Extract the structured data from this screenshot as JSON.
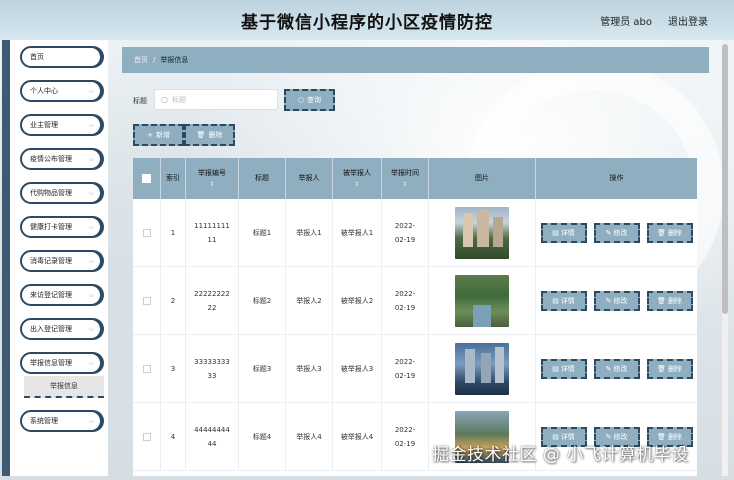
{
  "header": {
    "title": "基于微信小程序的小区疫情防控",
    "user_label": "管理员 abo",
    "logout_label": "退出登录"
  },
  "sidebar": {
    "items": [
      {
        "label": "首页"
      },
      {
        "label": "个人中心"
      },
      {
        "label": "业主管理"
      },
      {
        "label": "疫情公布管理"
      },
      {
        "label": "代购物品管理"
      },
      {
        "label": "健康打卡管理"
      },
      {
        "label": "消毒记录管理"
      },
      {
        "label": "来访登记管理"
      },
      {
        "label": "出入登记管理"
      },
      {
        "label": "举报信息管理"
      },
      {
        "label": "系统管理"
      }
    ],
    "sub_item": "举报信息",
    "chevron": "chevron-down-icon"
  },
  "breadcrumb": {
    "home": "首页",
    "separator": "/",
    "current": "举报信息"
  },
  "search": {
    "label": "标题",
    "placeholder": "标题",
    "button": "查询"
  },
  "actions": {
    "add": "新增",
    "delete": "删除"
  },
  "table": {
    "columns": [
      "索引",
      "举报编号",
      "标题",
      "举报人",
      "被举报人",
      "举报时间",
      "图片",
      "操作"
    ],
    "rows": [
      {
        "index": "1",
        "code": "1111111111",
        "title": "标题1",
        "reporter": "举报人1",
        "reported": "被举报人1",
        "time": "2022-02-19"
      },
      {
        "index": "2",
        "code": "2222222222",
        "title": "标题2",
        "reporter": "举报人2",
        "reported": "被举报人2",
        "time": "2022-02-19"
      },
      {
        "index": "3",
        "code": "3333333333",
        "title": "标题3",
        "reporter": "举报人3",
        "reported": "被举报人3",
        "time": "2022-02-19"
      },
      {
        "index": "4",
        "code": "4444444444",
        "title": "标题4",
        "reporter": "举报人4",
        "reported": "被举报人4",
        "time": "2022-02-19"
      }
    ],
    "row_actions": {
      "detail": "详情",
      "edit": "修改",
      "delete": "删除"
    }
  },
  "watermark": "掘金技术社区 @ 小飞计算机毕设",
  "colors": {
    "accent": "#8faebf",
    "sidebar_dark": "#3e5b73",
    "border_dark": "#2c4a63"
  }
}
